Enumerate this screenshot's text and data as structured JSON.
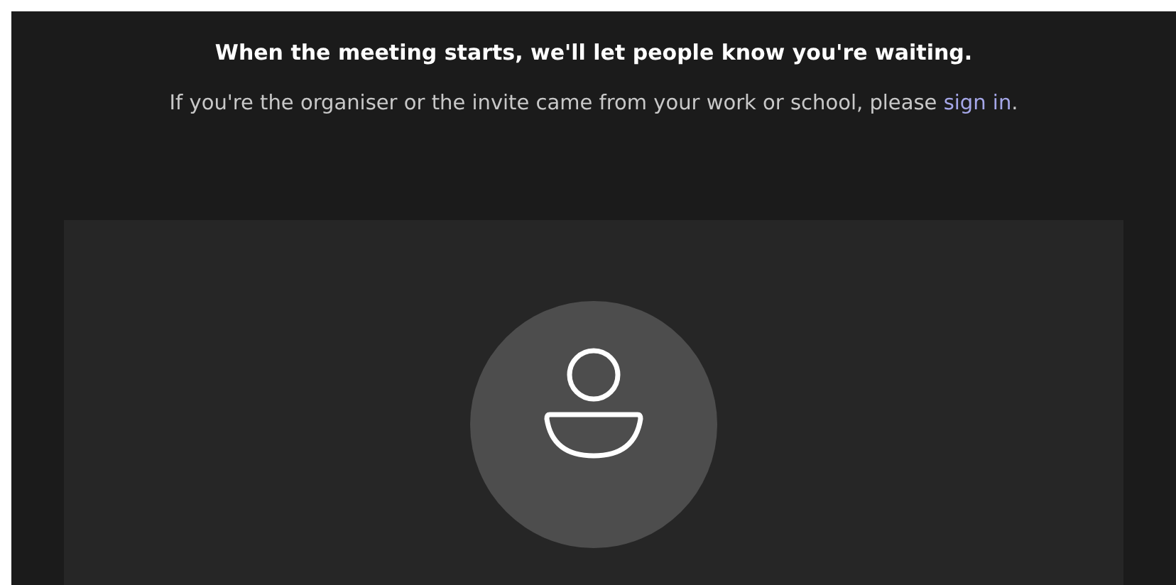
{
  "heading": "When the meeting starts, we'll let people know you're waiting.",
  "notice": {
    "text": "If you're the organiser or the invite came from your work or school, please ",
    "link": "sign in",
    "end": "."
  }
}
